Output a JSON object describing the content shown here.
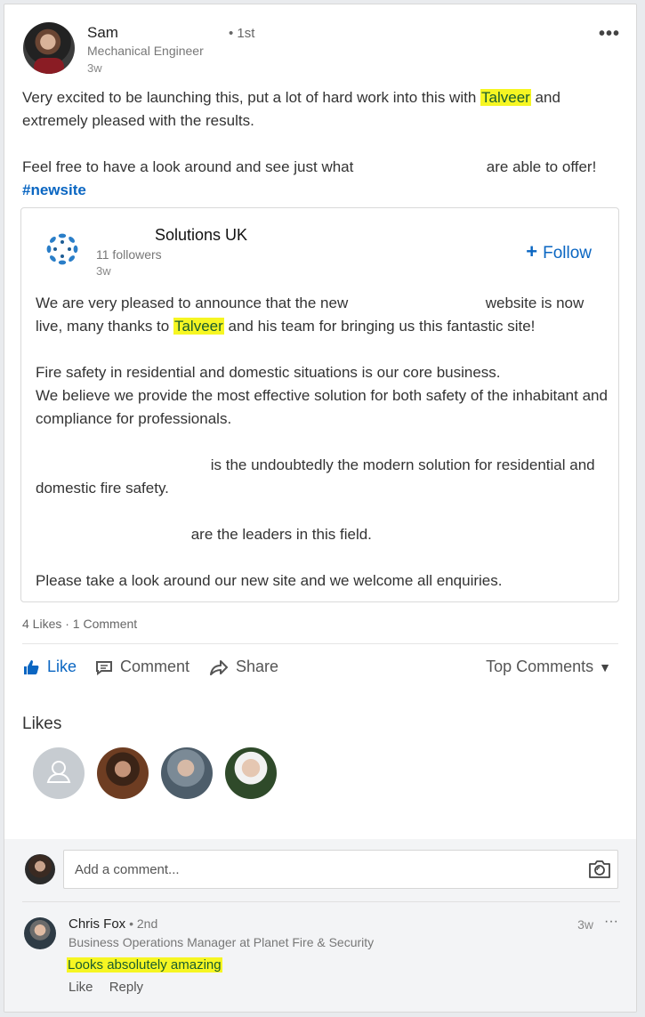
{
  "post": {
    "author": {
      "name": "Sam",
      "degree": "• 1st",
      "headline": "Mechanical Engineer",
      "time": "3w"
    },
    "more_label": "•••",
    "text": {
      "p1_before": "Very excited to be launching this, put a lot of hard work into this with ",
      "p1_highlight": "Talveer",
      "p1_after": " and extremely pleased with the results.",
      "p2_before": "Feel free to have a look around and see just what ",
      "p2_after": " are able to offer! ",
      "hashtag": "#newsite"
    }
  },
  "shared": {
    "company_name": "Solutions UK",
    "followers": "11 followers",
    "time": "3w",
    "follow_label": "Follow",
    "p1_before": "We are very pleased to announce that the new ",
    "p1_mid": " website is now live, many thanks to ",
    "p1_highlight": "Talveer",
    "p1_after": " and his team for bringing us this fantastic site!",
    "p2_line1": "Fire safety in residential and domestic situations is our core business.",
    "p2_line2": "We believe we provide the most effective solution for both safety of the inhabitant and compliance for professionals.",
    "p3": " is the undoubtedly the modern solution for residential and domestic fire safety.",
    "p4": " are the leaders in this field.",
    "p5": "Please take a look around our new site and we welcome all enquiries."
  },
  "social": {
    "counts": "4 Likes · 1 Comment",
    "like_label": "Like",
    "comment_label": "Comment",
    "share_label": "Share",
    "sort_label": "Top Comments"
  },
  "likes": {
    "title": "Likes"
  },
  "comment_input": {
    "placeholder": "Add a comment..."
  },
  "comment": {
    "author": "Chris Fox",
    "degree": " • 2nd",
    "headline": "Business Operations Manager at Planet Fire & Security",
    "body": "Looks absolutely amazing",
    "time": "3w",
    "more": "···",
    "like_label": "Like",
    "reply_label": "Reply"
  },
  "colors": {
    "link": "#0a66c2",
    "highlight": "#f6f622"
  }
}
